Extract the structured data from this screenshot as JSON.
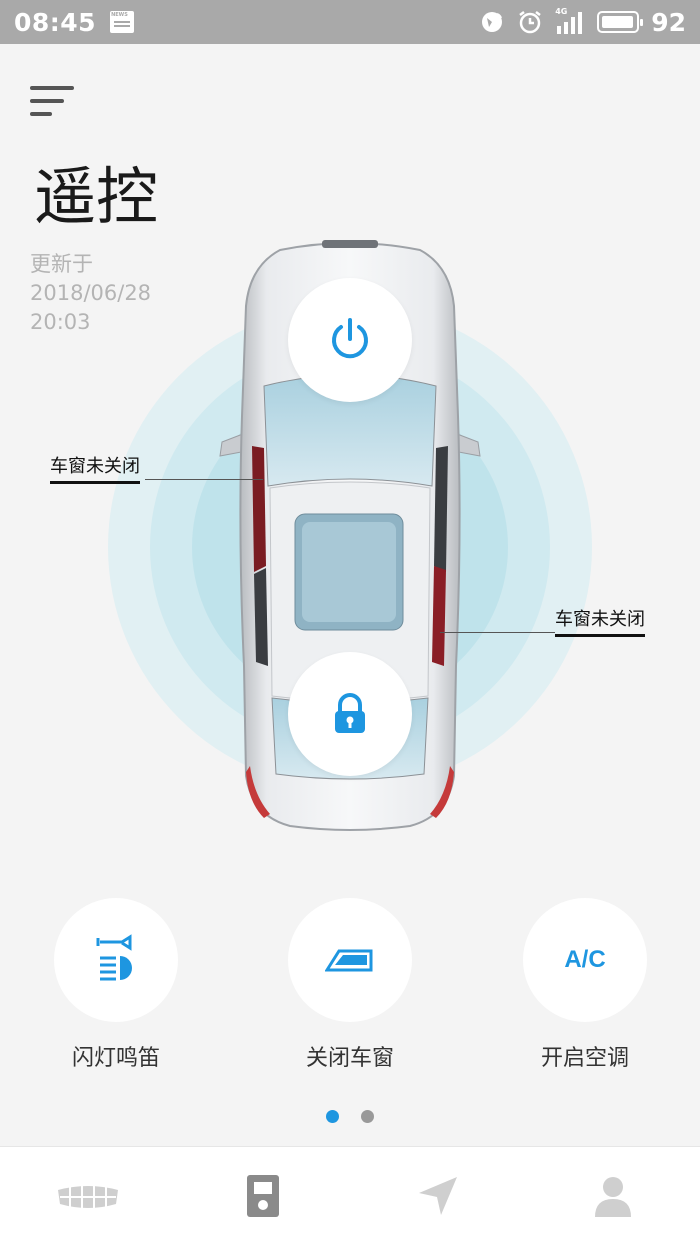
{
  "status_bar": {
    "time": "08:45",
    "battery": "92",
    "network": "4G",
    "icons": [
      "news-icon",
      "hotspot-icon",
      "alarm-icon",
      "signal-icon",
      "battery-icon"
    ]
  },
  "header": {
    "title": "遥控",
    "update_label": "更新于",
    "update_date": "2018/06/28",
    "update_time": "20:03"
  },
  "car": {
    "power_icon": "power-icon",
    "lock_icon": "lock-icon",
    "window_left_status": "车窗未关闭",
    "window_right_status": "车窗未关闭"
  },
  "actions": [
    {
      "label": "闪灯鸣笛",
      "icon": "horn-light-icon"
    },
    {
      "label": "关闭车窗",
      "icon": "car-window-icon"
    },
    {
      "label": "开启空调",
      "icon": "ac-icon"
    }
  ],
  "ac_icon_text": "A/C",
  "pagination": {
    "total": 2,
    "active": 1
  },
  "bottom_nav": [
    {
      "icon": "car-grille-icon"
    },
    {
      "icon": "remote-key-icon",
      "active": true
    },
    {
      "icon": "navigation-arrow-icon"
    },
    {
      "icon": "user-icon"
    }
  ],
  "colors": {
    "accent": "#1e96e0",
    "status_bar": "#a9a9a9",
    "background": "#f4f4f4",
    "nav_inactive": "#cfcfcf",
    "nav_active": "#8a8a8a"
  }
}
